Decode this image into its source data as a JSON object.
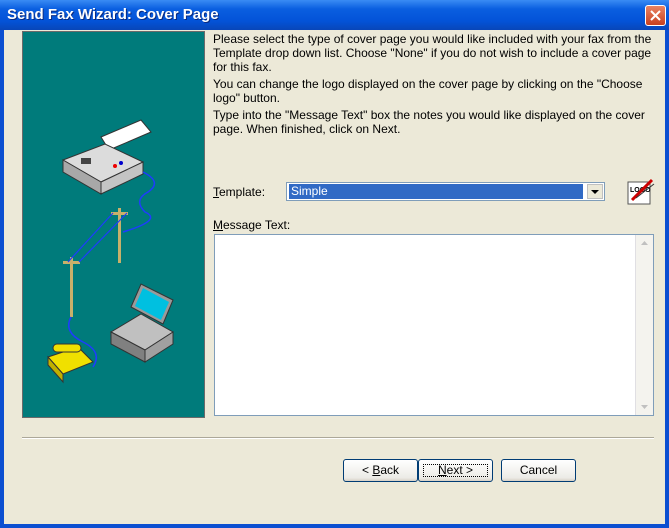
{
  "window": {
    "title": "Send Fax Wizard: Cover Page"
  },
  "intro": {
    "p1": "Please select the type of cover page you would like included with your fax from the Template drop down list. Choose \"None\" if you do not wish to include a cover page for this fax.",
    "p2": "You can change the logo displayed on the cover page by clicking on the \"Choose logo\" button.",
    "p3": "Type into the \"Message Text\" box the notes you would like displayed on the cover page. When finished, click on Next."
  },
  "template": {
    "label_rest": "emplate:",
    "label_mnemonic": "T",
    "value": "Simple"
  },
  "message": {
    "label_rest": "essage Text:",
    "label_mnemonic": "M",
    "value": ""
  },
  "buttons": {
    "back_mnemonic": "B",
    "back_rest": "ack",
    "back_prefix": "< ",
    "next_mnemonic": "N",
    "next_rest": "ext >",
    "cancel": "Cancel"
  },
  "colors": {
    "title_bar": "#0353d8",
    "panel": "#007b7b",
    "selection": "#316ac5"
  },
  "icons": [
    "close-icon",
    "fax-machine-icon",
    "telephone-icon",
    "laptop-icon",
    "choose-logo-icon",
    "dropdown-arrow-icon",
    "scroll-up-icon",
    "scroll-down-icon"
  ]
}
